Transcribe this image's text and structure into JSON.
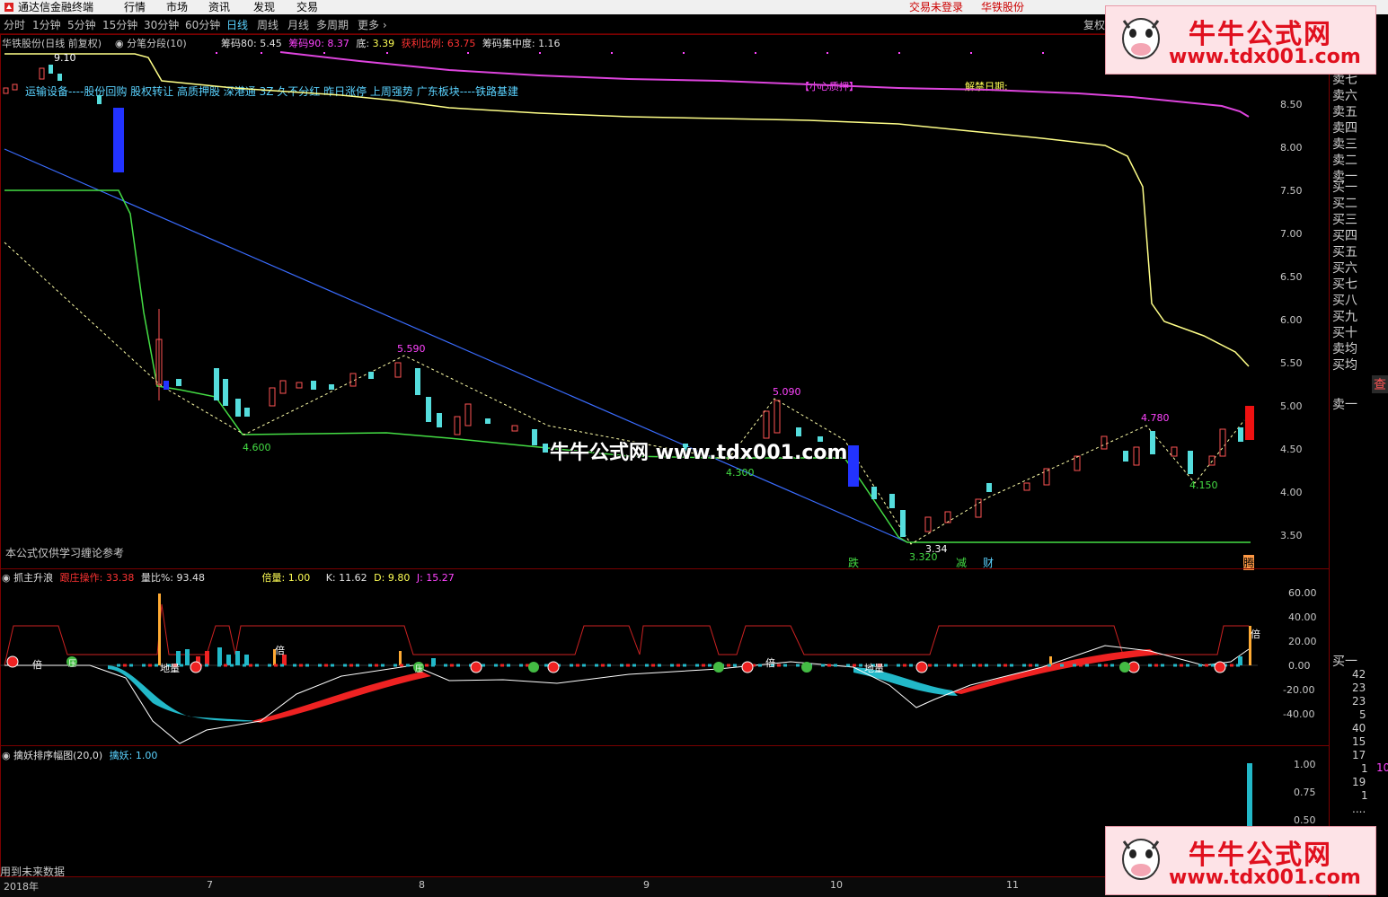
{
  "menubar": {
    "app_title": "通达信金融终端",
    "items": [
      "行情",
      "市场",
      "资讯",
      "发现",
      "交易"
    ],
    "login_status": "交易未登录",
    "stock_name": "华铁股份"
  },
  "periods": [
    "分时",
    "1分钟",
    "5分钟",
    "15分钟",
    "30分钟",
    "60分钟",
    "日线",
    "周线",
    "月线",
    "多周期",
    "更多 ›"
  ],
  "active_period": "日线",
  "restore_btn": "复权",
  "main_panel": {
    "title": "华铁股份(日线 前复权)",
    "indicator": "分笔分段(10)",
    "chip80_label": "筹码80:",
    "chip80_value": "5.45",
    "chip90_label": "筹码90:",
    "chip90_value": "8.37",
    "bottom_label": "底:",
    "bottom_value": "3.39",
    "profit_label": "获利比例:",
    "profit_value": "63.75",
    "conc_label": "筹码集中度:",
    "conc_value": "1.16",
    "concepts": "运输设备----股份回购 股权转让 高质押股 深港通 3Z 久不分红 昨日涨停 上周强势 广东板块----铁路基建",
    "pledge_tag": "【小心质押】",
    "unlock_tag": "解禁日期:",
    "disclaimer": "本公式仅供学习缠论参考",
    "pivot_labels": [
      {
        "text": "9.10"
      },
      {
        "text": "5.590"
      },
      {
        "text": "4.600"
      },
      {
        "text": "5.090"
      },
      {
        "text": "4.300"
      },
      {
        "text": "4.780"
      },
      {
        "text": "4.150"
      },
      {
        "text": "3.34"
      },
      {
        "text": "3.320"
      }
    ],
    "signals": [
      "跌",
      "减",
      "财",
      "腾"
    ],
    "y_ticks": [
      "8.50",
      "8.00",
      "7.50",
      "7.00",
      "6.50",
      "6.00",
      "5.50",
      "5.00",
      "4.50",
      "4.00",
      "3.50"
    ]
  },
  "sub_panel1": {
    "title": "抓主升浪",
    "f1_label": "跟庄操作:",
    "f1_value": "33.38",
    "f2_label": "量比%:",
    "f2_value": "93.48",
    "f3_label": "倍量:",
    "f3_value": "1.00",
    "k_label": "K:",
    "k_value": "11.62",
    "d_label": "D:",
    "d_value": "9.80",
    "j_label": "J:",
    "j_value": "15.27",
    "y_ticks": [
      "60.00",
      "40.00",
      "20.00",
      "0.00",
      "-20.00",
      "-40.00"
    ],
    "markers": [
      "倍",
      "压",
      "地量"
    ]
  },
  "sub_panel2": {
    "title": "擒妖排序幅图(20,0)",
    "f1_label": "擒妖:",
    "f1_value": "1.00",
    "y_ticks": [
      "1.00",
      "0.75",
      "0.50"
    ]
  },
  "footer": {
    "future_note": "用到未来数据",
    "date_labels": [
      "2018年",
      "7",
      "8",
      "9",
      "10",
      "11"
    ]
  },
  "order_book": {
    "sell": [
      "卖七",
      "卖六",
      "卖五",
      "卖四",
      "卖三",
      "卖二",
      "卖一"
    ],
    "buy": [
      "买一",
      "买二",
      "买三",
      "买四",
      "买五",
      "买六",
      "买七",
      "买八",
      "买九",
      "买十"
    ],
    "avg": [
      "卖均",
      "买均"
    ],
    "sell_one": "卖一",
    "buy_one": "买一",
    "query_btn": "查",
    "depth_numbers": [
      "42",
      "23",
      "23",
      "5",
      "40",
      "15",
      "17",
      "1",
      "19",
      "1",
      "...."
    ],
    "depth_side": "10"
  },
  "watermark": {
    "title": "牛牛公式网",
    "url": "www.tdx001.com",
    "center_text": "牛牛公式网 www.tdx001.com"
  }
}
